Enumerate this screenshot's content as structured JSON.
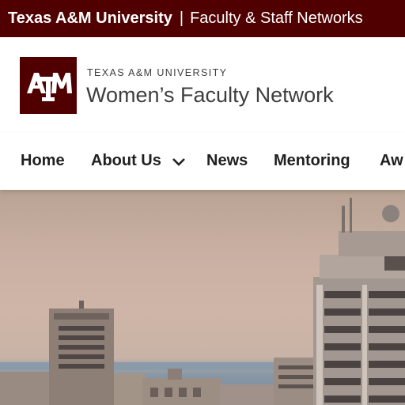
{
  "topbar": {
    "university": "Texas A&M University",
    "separator": "|",
    "networks": "Faculty & Staff Networks"
  },
  "header": {
    "logo_text": "ATM",
    "university_small": "TEXAS A&M UNIVERSITY",
    "site_title": "Women’s Faculty Network"
  },
  "nav": {
    "items": [
      {
        "label": "Home"
      },
      {
        "label": "About Us"
      },
      {
        "label": "News"
      },
      {
        "label": "Mentoring"
      },
      {
        "label": "Aw"
      }
    ]
  },
  "colors": {
    "maroon": "#500000",
    "text": "#3e3e3e",
    "nav_text": "#202020"
  },
  "hero": {
    "icon": "campus-skyline-photo"
  }
}
